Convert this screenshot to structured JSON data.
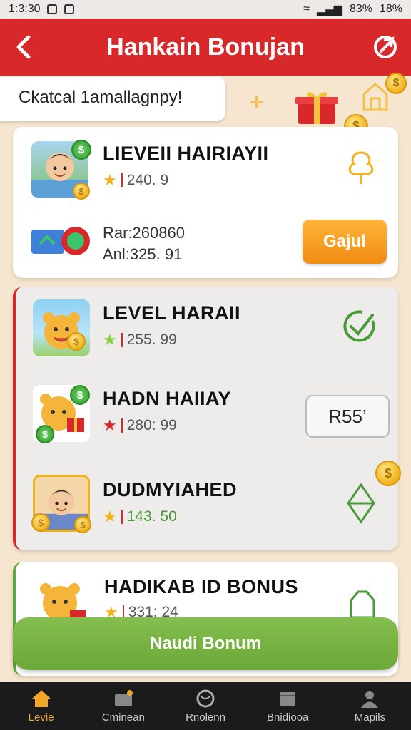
{
  "status_bar": {
    "time": "1:3:30",
    "battery_left": "83%",
    "battery_right": "18%"
  },
  "header": {
    "title": "Hankain Bonujan",
    "back_icon": "back-arrow-icon",
    "refresh_icon": "refresh-icon"
  },
  "subtitle": "Ckatcal 1amallagnpy!",
  "card1": {
    "title": "LIEVEII HAIRIAYII",
    "score": "240. 9",
    "info_line1": "Rar:260860",
    "info_line2": "Anl:325. 91",
    "button_label": "Gajul"
  },
  "card2": {
    "rows": [
      {
        "title": "LEVEL HARAII",
        "score": "255. 99"
      },
      {
        "title": "HADN HAIIAY",
        "score": "280: 99",
        "button_label": "R55’"
      },
      {
        "title": "DUDMYIAHED",
        "score": "143. 50"
      }
    ]
  },
  "card4": {
    "title": "HADIKAB ID BONUS",
    "score": "331: 24"
  },
  "cta_label": "Naudi Bonum",
  "bottom_nav": [
    {
      "label": "Levie",
      "active": true
    },
    {
      "label": "Cminean",
      "active": false
    },
    {
      "label": "Rnolenn",
      "active": false
    },
    {
      "label": "Bnidiooa",
      "active": false
    },
    {
      "label": "Mapils",
      "active": false
    }
  ],
  "colors": {
    "primary_red": "#d8282a",
    "accent_orange": "#f08c12",
    "accent_green": "#6aa838"
  }
}
